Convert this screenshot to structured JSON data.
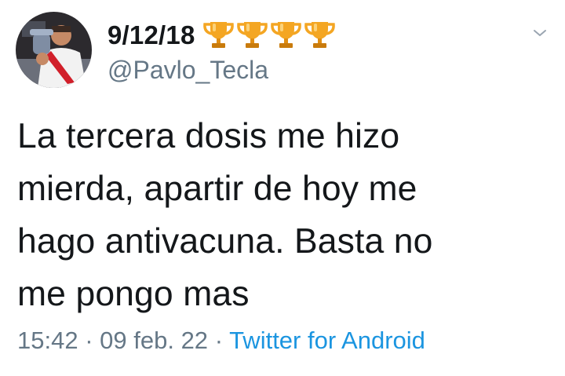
{
  "tweet": {
    "display_name": "9/12/18",
    "display_name_emoji": [
      "trophy-icon",
      "trophy-icon",
      "trophy-icon",
      "trophy-icon"
    ],
    "handle": "@Pavlo_Tecla",
    "text": "La tercera dosis me hizo\nmierda, apartir de hoy me\nhago antivacuna. Basta no\nme pongo mas",
    "time": "15:42",
    "separator": "·",
    "date": "09 feb. 22",
    "source": "Twitter for Android",
    "menu_icon": "chevron-down-icon",
    "avatar_icon": "profile-photo"
  },
  "colors": {
    "text": "#14171a",
    "secondary": "#657786",
    "link": "#1b95e0",
    "trophy": "#f4a623",
    "trophy_dark": "#c97b0c"
  }
}
